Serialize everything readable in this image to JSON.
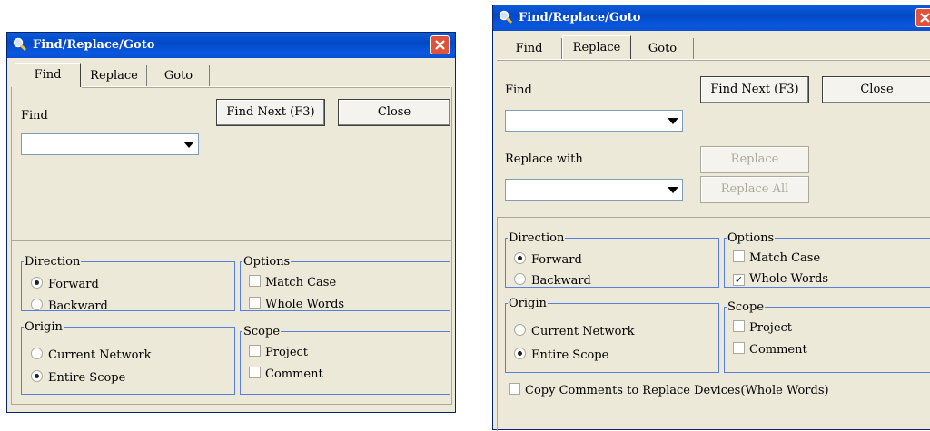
{
  "left_dialog": {
    "title": "Find/Replace/Goto",
    "tabs": [
      {
        "label": "Find",
        "active": true
      },
      {
        "label": "Replace",
        "active": false
      },
      {
        "label": "Goto",
        "active": false
      }
    ],
    "find_label": "Find",
    "find_value": "",
    "find_next_label": "Find Next (F3)",
    "close_label": "Close",
    "direction": {
      "label": "Direction",
      "forward": "Forward",
      "backward": "Backward",
      "selected": "Forward"
    },
    "options": {
      "label": "Options",
      "match_case": "Match Case",
      "whole_words": "Whole Words",
      "match_case_checked": false,
      "whole_words_checked": false
    },
    "origin": {
      "label": "Origin",
      "current_network": "Current Network",
      "entire_scope": "Entire Scope",
      "selected": "Entire Scope"
    },
    "scope": {
      "label": "Scope",
      "project": "Project",
      "comment": "Comment",
      "project_checked": false,
      "comment_checked": false
    }
  },
  "right_dialog": {
    "title": "Find/Replace/Goto",
    "tabs": [
      {
        "label": "Find",
        "active": false
      },
      {
        "label": "Replace",
        "active": true
      },
      {
        "label": "Goto",
        "active": false
      }
    ],
    "find_label": "Find",
    "find_value": "",
    "find_next_label": "Find Next (F3)",
    "close_label": "Close",
    "replace_with_label": "Replace with",
    "replace_value": "",
    "replace_label": "Replace",
    "replace_all_label": "Replace All",
    "direction": {
      "label": "Direction",
      "forward": "Forward",
      "backward": "Backward",
      "selected": "Forward"
    },
    "options": {
      "label": "Options",
      "match_case": "Match Case",
      "whole_words": "Whole Words",
      "match_case_checked": false,
      "whole_words_checked": true
    },
    "origin": {
      "label": "Origin",
      "current_network": "Current Network",
      "entire_scope": "Entire Scope",
      "selected": "Entire Scope"
    },
    "scope": {
      "label": "Scope",
      "project": "Project",
      "comment": "Comment",
      "project_checked": false,
      "comment_checked": false
    },
    "copy_comments_label": "Copy Comments to Replace Devices(Whole Words)",
    "copy_comments_checked": false
  },
  "colors": {
    "titlebar": "#0348c5",
    "dialog_bg": "#ece9d8",
    "close_button": "#e0533a",
    "group_border": "#5a7edc"
  }
}
